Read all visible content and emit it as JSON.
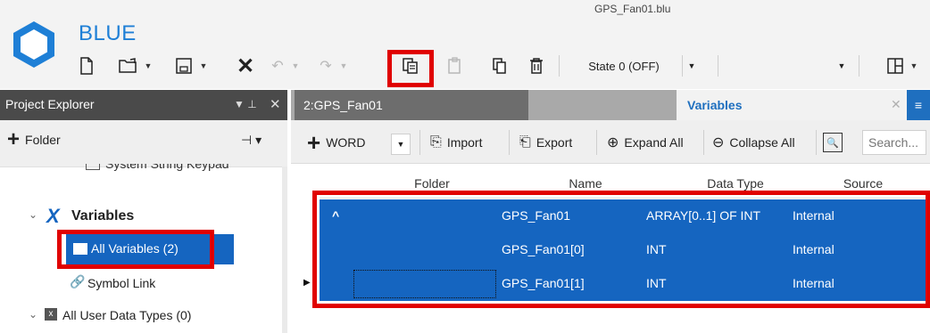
{
  "app": {
    "name": "BLUE",
    "file_title": "GPS_Fan01.blu"
  },
  "toolbar": {
    "state_value": "State 0 (OFF)",
    "icons": [
      "new-file-icon",
      "open-folder-icon",
      "save-icon",
      "delete-x-icon",
      "undo-icon",
      "redo-icon",
      "copy-icon",
      "paste-icon",
      "duplicate-icon",
      "trash-icon",
      "layout-icon"
    ]
  },
  "project_explorer": {
    "title": "Project Explorer",
    "folder_button": "Folder",
    "tree": {
      "partial_item": "System String Keypad",
      "variables": "Variables",
      "all_variables": "All Variables (2)",
      "symbol_link": "Symbol Link",
      "all_user_data_types": "All User Data Types (0)"
    }
  },
  "tabs": {
    "doc_tab": "2:GPS_Fan01",
    "variables_tab": "Variables"
  },
  "variables_toolbar": {
    "type_dropdown": "WORD",
    "import": "Import",
    "export": "Export",
    "expand_all": "Expand All",
    "collapse_all": "Collapse All",
    "search_placeholder": "Search..."
  },
  "grid": {
    "columns": [
      "Folder",
      "Name",
      "Data Type",
      "Source"
    ],
    "rows": [
      {
        "expander": "^",
        "name": "GPS_Fan01",
        "data_type": "ARRAY[0..1] OF INT",
        "source": "Internal"
      },
      {
        "expander": "",
        "name": "GPS_Fan01[0]",
        "data_type": "INT",
        "source": "Internal"
      },
      {
        "expander": "",
        "name": "GPS_Fan01[1]",
        "data_type": "INT",
        "source": "Internal"
      }
    ]
  },
  "colors": {
    "accent": "#1565c0",
    "highlight": "#e00000",
    "brand": "#1e7fd6"
  }
}
